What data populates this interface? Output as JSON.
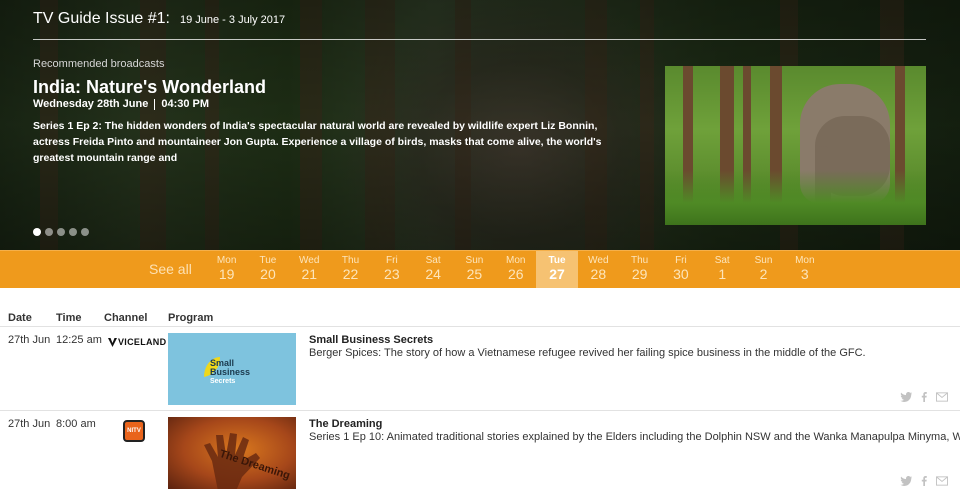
{
  "header": {
    "title": "TV Guide Issue #1:",
    "dates": "19 June - 3 July 2017"
  },
  "featured": {
    "label": "Recommended broadcasts",
    "title": "India: Nature's Wonderland",
    "day": "Wednesday 28th June",
    "time": "04:30 PM",
    "description": "Series 1 Ep 2: The hidden wonders of India's spectacular natural world are revealed by wildlife expert Liz Bonnin, actress Freida Pinto and mountaineer Jon Gupta. Experience a village of birds, masks that come alive, the world's greatest mountain range and",
    "carousel_count": 5,
    "carousel_active_index": 0
  },
  "datebar": {
    "see_all": "See all",
    "active_index": 8,
    "days": [
      {
        "name": "Mon",
        "num": "19"
      },
      {
        "name": "Tue",
        "num": "20"
      },
      {
        "name": "Wed",
        "num": "21"
      },
      {
        "name": "Thu",
        "num": "22"
      },
      {
        "name": "Fri",
        "num": "23"
      },
      {
        "name": "Sat",
        "num": "24"
      },
      {
        "name": "Sun",
        "num": "25"
      },
      {
        "name": "Mon",
        "num": "26"
      },
      {
        "name": "Tue",
        "num": "27"
      },
      {
        "name": "Wed",
        "num": "28"
      },
      {
        "name": "Thu",
        "num": "29"
      },
      {
        "name": "Fri",
        "num": "30"
      },
      {
        "name": "Sat",
        "num": "1"
      },
      {
        "name": "Sun",
        "num": "2"
      },
      {
        "name": "Mon",
        "num": "3"
      }
    ]
  },
  "table": {
    "columns": {
      "date": "Date",
      "time": "Time",
      "channel": "Channel",
      "program": "Program"
    },
    "rows": [
      {
        "date": "27th Jun",
        "time": "12:25 am",
        "channel": "VICELAND",
        "title": "Small Business Secrets",
        "thumb_line1": "Small",
        "thumb_line2": "Business",
        "thumb_line3": "Secrets",
        "description": "Berger Spices: The story of how a Vietnamese refugee revived her failing spice business in the middle of the GFC."
      },
      {
        "date": "27th Jun",
        "time": "8:00 am",
        "channel": "NITV",
        "title": "The Dreaming",
        "thumb_text": "The Dreaming",
        "description": "Series 1 Ep 10: Animated traditional stories explained by the Elders including the Dolphin NSW and the Wanka Manapulpa Minyma, WA"
      }
    ]
  },
  "social_icons": [
    "twitter-icon",
    "facebook-icon",
    "email-icon"
  ]
}
